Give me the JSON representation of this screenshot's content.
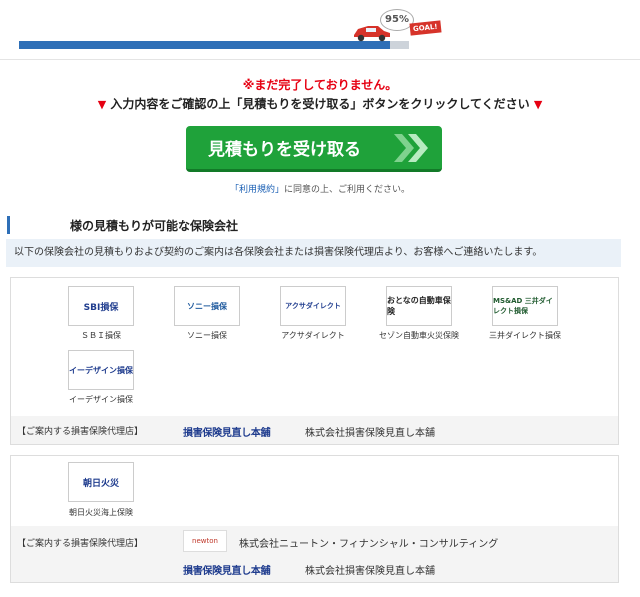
{
  "progress": {
    "percent_label": "95%",
    "goal_label": "GOAL!",
    "fraction": 0.95
  },
  "warning": "※まだ完了しておりません。",
  "instruction": "入力内容をご確認の上「見積もりを受け取る」ボタンをクリックしてください",
  "submit_label": "見積もりを受け取る",
  "terms": {
    "link": "「利用規約」",
    "rest": "に同意の上、ご利用ください。"
  },
  "section_title": "様の見積もりが可能な保険会社",
  "notice": "以下の保険会社の見積もりおよび契約のご案内は各保険会社または損害保険代理店より、お客様へご連絡いたします。",
  "insurers_group1": [
    {
      "logo_text": "SBI損保",
      "name": "ＳＢＩ損保"
    },
    {
      "logo_text": "ソニー損保",
      "name": "ソニー損保"
    },
    {
      "logo_text": "アクサダイレクト",
      "name": "アクサダイレクト"
    },
    {
      "logo_text": "おとなの自動車保険",
      "name": "セゾン自動車火災保険"
    },
    {
      "logo_text": "MS&AD 三井ダイレクト損保",
      "name": "三井ダイレクト損保"
    },
    {
      "logo_text": "イーデザイン損保",
      "name": "イーデザイン損保"
    }
  ],
  "agency_label": "【ご案内する損害保険代理店】",
  "agency1": {
    "logo_text": "損害保険見直し本舗",
    "name": "株式会社損害保険見直し本舗"
  },
  "insurers_group2": [
    {
      "logo_text": "朝日火災",
      "name": "朝日火災海上保険"
    }
  ],
  "agency2": [
    {
      "logo_text": "newton",
      "name": "株式会社ニュートン・フィナンシャル・コンサルティング"
    },
    {
      "logo_text": "損害保険見直し本舗",
      "name": "株式会社損害保険見直し本舗"
    }
  ],
  "colors": {
    "accent": "#2e6fb7",
    "button": "#1fa23a",
    "warning": "#e60012"
  }
}
